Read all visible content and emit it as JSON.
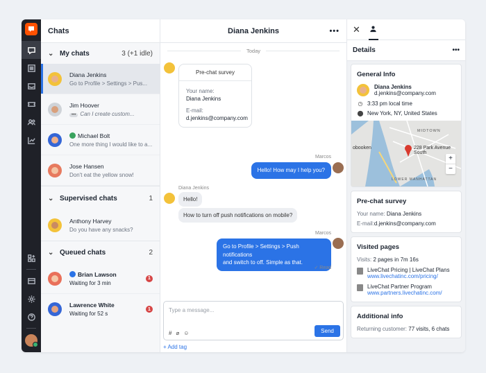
{
  "list": {
    "title": "Chats",
    "groups": {
      "my_chats": {
        "title": "My chats",
        "count": "3 (+1 idle)"
      },
      "supervised": {
        "title": "Supervised chats",
        "count": "1"
      },
      "queued": {
        "title": "Queued chats",
        "count": "2"
      }
    },
    "my_chats": [
      {
        "name": "Diana Jenkins",
        "preview": "Go to Profile > Settings > Pus..."
      },
      {
        "name": "Jim Hoover",
        "preview": "Can I create custom...",
        "typing": "•••"
      },
      {
        "name": "Michael Bolt",
        "preview": "One more thing I would like to a..."
      },
      {
        "name": "Jose Hansen",
        "preview": "Don't eat the yellow snow!"
      }
    ],
    "supervised_chats": [
      {
        "name": "Anthony Harvey",
        "preview": "Do you have any snacks?"
      }
    ],
    "queued_chats": [
      {
        "name": "Brian Lawson",
        "status": "Waiting for 3 min",
        "badge": "1"
      },
      {
        "name": "Lawrence White",
        "status": "Waiting for 52 s",
        "badge": "1"
      }
    ]
  },
  "conversation": {
    "title": "Diana Jenkins",
    "more": "•••",
    "date_divider": "Today",
    "prechat": {
      "title": "Pre-chat survey",
      "name_label": "Your name:",
      "name_value": "Diana Jenkins",
      "email_label": "E-mail:",
      "email_value": "d.jenkins@company.com"
    },
    "messages": [
      {
        "sender": "Marcos",
        "text": "Hello! How may I help you?"
      },
      {
        "sender": "Diana Jenkins",
        "text": "Hello!"
      },
      {
        "text": "How to turn off push notifications on mobile?"
      },
      {
        "sender": "Marcos",
        "text_line1": "Go to Profile > Settings > Push notifications",
        "text_line2": "and switch to off. Simple as that.",
        "status": "✓ Read"
      }
    ],
    "composer": {
      "placeholder": "Type a message...",
      "send_label": "Send",
      "add_tag": "+ Add tag",
      "tool_hash": "#",
      "tool_attach": "⌀",
      "tool_emoji": "☺"
    }
  },
  "details": {
    "close": "✕",
    "title": "Details",
    "more": "•••",
    "general": {
      "title": "General Info",
      "name": "Diana Jenkins",
      "email": "d.jenkins@company.com",
      "local_time": "3:33 pm local time",
      "location": "New York, NY, United States",
      "map_label": "228 Park Avenue South",
      "map_label_left": "obooken",
      "map_label_midtown": "MIDTOWN",
      "map_label_lower": "LOWER MANHATTAN",
      "zoom_in": "+",
      "zoom_out": "−"
    },
    "prechat": {
      "title": "Pre-chat survey",
      "name_label": "Your name:",
      "name_value": "Diana Jenkins",
      "email_label": "E-mail:",
      "email_value": "d.jenkins@company.com"
    },
    "visited": {
      "title": "Visited pages",
      "visits_label": "Visits:",
      "visits_value": "2 pages in 7m 16s",
      "pages": [
        {
          "title": "LiveChat Pricing | LiveChat Plans",
          "url": "www.livechatinc.com/pricing/"
        },
        {
          "title": "LiveChat Partner Program",
          "url": "www.partners.livechatinc.com/"
        }
      ]
    },
    "additional": {
      "title": "Additional info",
      "returning_label": "Returning customer:",
      "returning_value": "77 visits, 6 chats"
    }
  },
  "colors": {
    "brand": "#ff5100",
    "accent": "#2b73e6",
    "rail": "#1f2128",
    "badge": "#d64646"
  }
}
